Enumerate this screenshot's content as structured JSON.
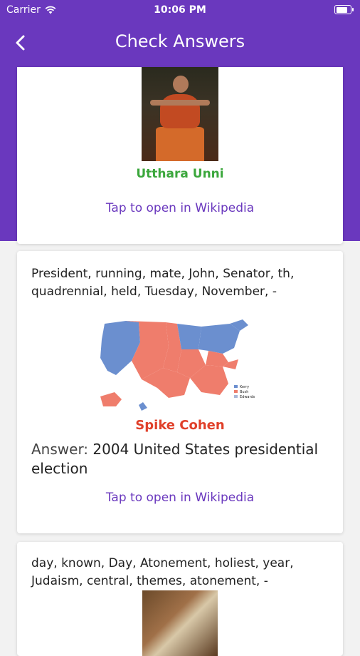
{
  "status_bar": {
    "carrier": "Carrier",
    "time": "10:06 PM"
  },
  "header": {
    "title": "Check Answers",
    "back_icon": "chevron-left-icon"
  },
  "colors": {
    "header_bg": "#6a38be",
    "correct": "#3ba73c",
    "incorrect": "#e0402a",
    "link": "#6a38be"
  },
  "cards": [
    {
      "guess": "Utthara Unni",
      "link_text": "Tap to open in Wikipedia"
    },
    {
      "clue": "President, running, mate, John, Senator, th, quadrennial, held, Tuesday, November, -",
      "guess": "Spike Cohen",
      "answer_label": "Answer:",
      "answer": "2004 United States presidential election",
      "link_text": "Tap to open in Wikipedia",
      "map_legend": [
        "Kerry",
        "Bush",
        "Edwards"
      ]
    },
    {
      "clue": "day, known, Day, Atonement, holiest, year, Judaism, central, themes, atonement, -"
    }
  ]
}
